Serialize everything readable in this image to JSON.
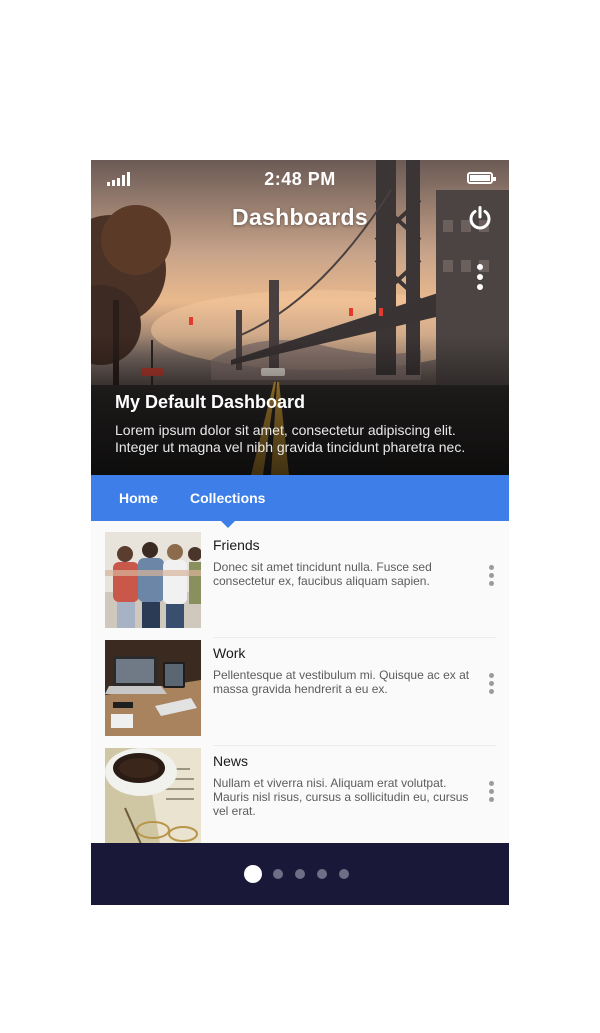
{
  "status_bar": {
    "time": "2:48 PM"
  },
  "header": {
    "title": "Dashboards"
  },
  "hero": {
    "title": "My Default Dashboard",
    "description": "Lorem ipsum dolor sit amet, consectetur adipiscing elit. Integer ut magna vel nibh gravida tincidunt pharetra nec."
  },
  "tabs": [
    {
      "label": "Home"
    },
    {
      "label": "Collections",
      "active": true
    }
  ],
  "items": [
    {
      "name": "Friends",
      "description": "Donec sit amet tincidunt nulla. Fusce sed consectetur ex, faucibus aliquam sapien."
    },
    {
      "name": "Work",
      "description": "Pellentesque at vestibulum mi. Quisque ac ex at massa gravida hendrerit a eu ex."
    },
    {
      "name": "News",
      "description": "Nullam et viverra nisi. Aliquam erat volutpat. Mauris nisl risus, cursus a sollicitudin eu, cursus vel erat."
    }
  ],
  "pagination": {
    "total": 5,
    "current": 1
  },
  "colors": {
    "accent": "#3d7ee8",
    "footer": "#1a1838"
  },
  "icons": [
    "signal-icon",
    "battery-icon",
    "power-icon",
    "more-vert-icon"
  ]
}
